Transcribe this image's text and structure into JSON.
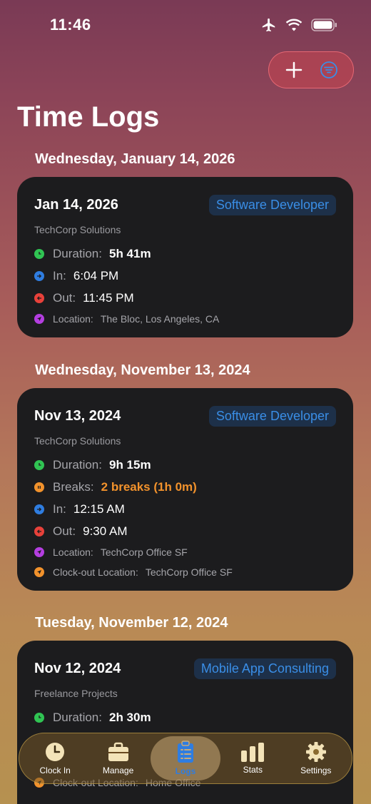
{
  "status": {
    "time": "11:46"
  },
  "header": {
    "title": "Time Logs"
  },
  "sections": [
    {
      "day": "Wednesday, January 14, 2026"
    },
    {
      "day": "Wednesday, November 13, 2024"
    },
    {
      "day": "Tuesday, November 12, 2024"
    }
  ],
  "cards": [
    {
      "date": "Jan 14, 2026",
      "job": "Software Developer",
      "company": "TechCorp Solutions",
      "duration_label": "Duration:",
      "duration": "5h 41m",
      "in_label": "In:",
      "in": "6:04 PM",
      "out_label": "Out:",
      "out": "11:45 PM",
      "location_label": "Location:",
      "location": "The Bloc, Los Angeles, CA"
    },
    {
      "date": "Nov 13, 2024",
      "job": "Software Developer",
      "company": "TechCorp Solutions",
      "duration_label": "Duration:",
      "duration": "9h 15m",
      "breaks_label": "Breaks:",
      "breaks": "2 breaks (1h 0m)",
      "in_label": "In:",
      "in": "12:15 AM",
      "out_label": "Out:",
      "out": "9:30 AM",
      "location_label": "Location:",
      "location": "TechCorp Office SF",
      "clockout_label": "Clock-out Location:",
      "clockout": "TechCorp Office SF"
    },
    {
      "date": "Nov 12, 2024",
      "job": "Mobile App Consulting",
      "company": "Freelance Projects",
      "duration_label": "Duration:",
      "duration": "2h 30m",
      "clockout_label": "Clock-out Location:",
      "clockout": "Home Office"
    }
  ],
  "tabs": [
    {
      "label": "Clock In",
      "icon": "clock-icon"
    },
    {
      "label": "Manage",
      "icon": "briefcase-icon"
    },
    {
      "label": "Logs",
      "icon": "clipboard-icon",
      "active": true
    },
    {
      "label": "Stats",
      "icon": "bar-chart-icon"
    },
    {
      "label": "Settings",
      "icon": "gear-icon"
    }
  ],
  "colors": {
    "green": "#30c453",
    "blue": "#2f7de0",
    "red": "#e8413a",
    "purple": "#b43ee0",
    "orange": "#f2922c",
    "badge_text": "#3a8ee6"
  }
}
